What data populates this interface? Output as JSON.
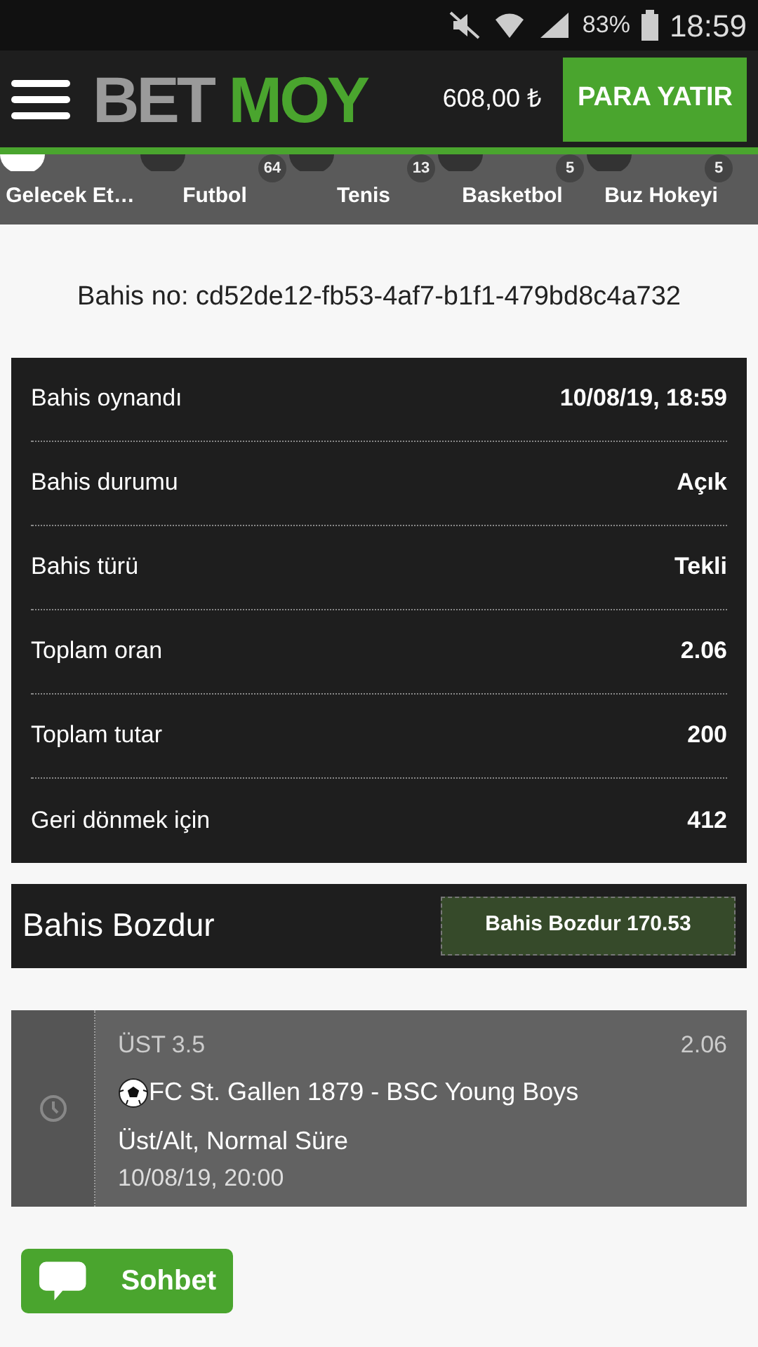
{
  "status_bar": {
    "battery": "83%",
    "time": "18:59"
  },
  "header": {
    "logo_left": "BET",
    "logo_right": "MOY",
    "balance": "608,00 ₺",
    "deposit_button": "PARA YATIR"
  },
  "sports": [
    {
      "label": "Gelecek Et…"
    },
    {
      "label": "Futbol",
      "count": "64"
    },
    {
      "label": "Tenis",
      "count": "13"
    },
    {
      "label": "Basketbol",
      "count": "5"
    },
    {
      "label": "Buz Hokeyi",
      "count": "5"
    }
  ],
  "bet_id": "Bahis no: cd52de12-fb53-4af7-b1f1-479bd8c4a732",
  "details": [
    {
      "label": "Bahis oynandı",
      "value": "10/08/19, 18:59"
    },
    {
      "label": "Bahis durumu",
      "value": "Açık"
    },
    {
      "label": "Bahis türü",
      "value": "Tekli"
    },
    {
      "label": "Toplam oran",
      "value": "2.06"
    },
    {
      "label": "Toplam tutar",
      "value": "200"
    },
    {
      "label": "Geri dönmek için",
      "value": "412"
    }
  ],
  "cashout": {
    "title": "Bahis Bozdur",
    "button": "Bahis Bozdur 170.53"
  },
  "selection": {
    "pick": "ÜST 3.5",
    "odds": "2.06",
    "match": "FC St. Gallen 1879 - BSC Young Boys",
    "market": "Üst/Alt, Normal Süre",
    "time": "10/08/19, 20:00"
  },
  "chat_button": "Sohbet"
}
